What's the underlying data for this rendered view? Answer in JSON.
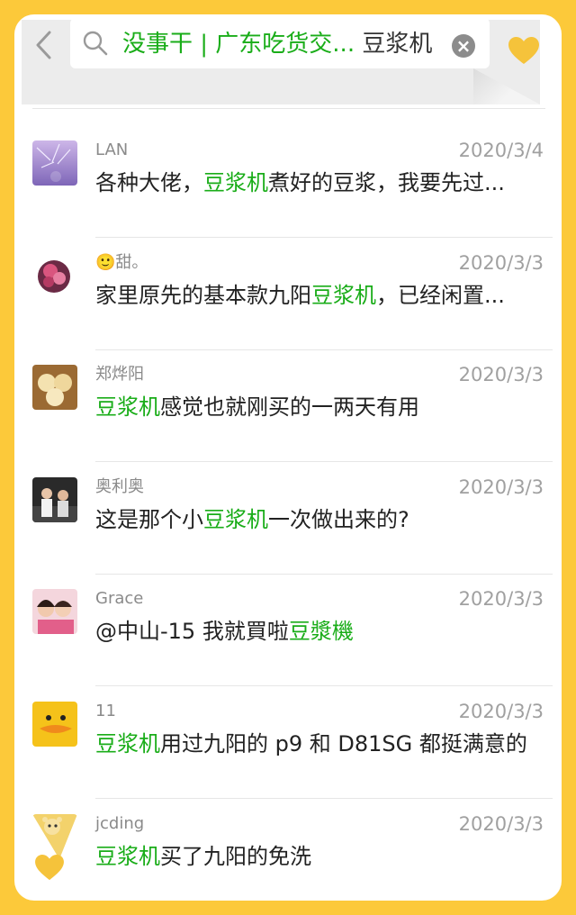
{
  "header": {
    "back_label": "‹",
    "search_query_prefix": "没事干 | 广东吃货交...",
    "search_query_term": "豆浆机",
    "clear_label": "×"
  },
  "colors": {
    "background": "#fcc93a",
    "highlight": "#1aad19",
    "heart": "#f5c33b"
  },
  "messages": [
    {
      "name": "LAN",
      "date": "2020/3/4",
      "pre": "各种大佬，",
      "hl": "豆浆机",
      "post": "煮好的豆浆，我要先过..."
    },
    {
      "name": "🙂甜。",
      "date": "2020/3/3",
      "pre": "家里原先的基本款九阳",
      "hl": "豆浆机",
      "post": "，已经闲置..."
    },
    {
      "name": "郑烨阳",
      "date": "2020/3/3",
      "pre": "",
      "hl": "豆浆机",
      "post": "感觉也就刚买的一两天有用"
    },
    {
      "name": "奥利奥",
      "date": "2020/3/3",
      "pre": "这是那个小",
      "hl": "豆浆机",
      "post": "一次做出来的?"
    },
    {
      "name": "Grace",
      "date": "2020/3/3",
      "pre": "@中山-15 我就買啦",
      "hl": "豆漿機",
      "post": ""
    },
    {
      "name": "11",
      "date": "2020/3/3",
      "pre": "",
      "hl": "豆浆机",
      "post": "用过九阳的 p9 和 D81SG 都挺满意的"
    },
    {
      "name": "jcding",
      "date": "2020/3/3",
      "pre": "",
      "hl": "豆浆机",
      "post": "买了九阳的免洗"
    }
  ]
}
